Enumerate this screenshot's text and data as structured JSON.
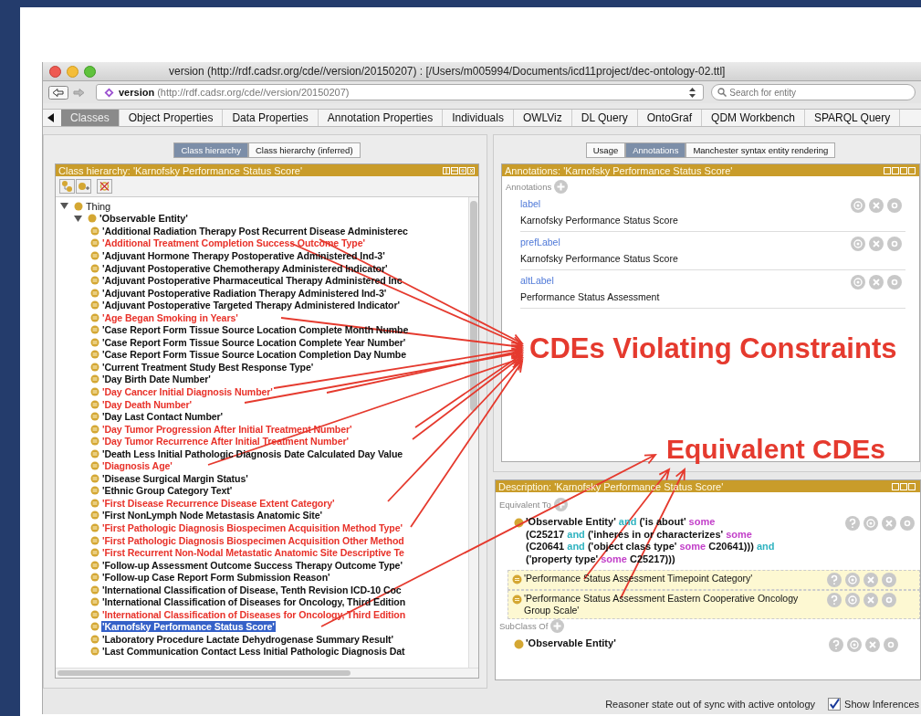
{
  "window": {
    "title": "version (http://rdf.cadsr.org/cde//version/20150207)  : [/Users/m005994/Documents/icd11project/dec-ontology-02.ttl]"
  },
  "address_bar": {
    "entity": "version",
    "iri": "(http://rdf.cadsr.org/cde//version/20150207)"
  },
  "search": {
    "placeholder": "Search for entity"
  },
  "tabs": [
    {
      "label": "Classes",
      "selected": true
    },
    {
      "label": "Object Properties",
      "selected": false
    },
    {
      "label": "Data Properties",
      "selected": false
    },
    {
      "label": "Annotation Properties",
      "selected": false
    },
    {
      "label": "Individuals",
      "selected": false
    },
    {
      "label": "OWLViz",
      "selected": false
    },
    {
      "label": "DL Query",
      "selected": false
    },
    {
      "label": "OntoGraf",
      "selected": false
    },
    {
      "label": "QDM Workbench",
      "selected": false
    },
    {
      "label": "SPARQL Query",
      "selected": false
    }
  ],
  "class_panel": {
    "tabs": [
      {
        "label": "Class hierarchy",
        "selected": true
      },
      {
        "label": "Class hierarchy (inferred)",
        "selected": false
      }
    ],
    "header": "Class hierarchy: 'Karnofsky Performance Status Score'",
    "tree": [
      {
        "label": "Thing",
        "expanded": true,
        "children": [
          {
            "label": "'Observable Entity'",
            "expanded": true,
            "children": [
              {
                "label": "'Additional Radiation Therapy Post Recurrent Disease Administerec",
                "flagged": false,
                "selected": false
              },
              {
                "label": "'Additional Treatment Completion Success Outcome Type'",
                "flagged": true,
                "selected": false
              },
              {
                "label": "'Adjuvant Hormone Therapy Postoperative Administered Ind-3'",
                "flagged": false,
                "selected": false
              },
              {
                "label": "'Adjuvant Postoperative Chemotherapy Administered Indicator'",
                "flagged": false,
                "selected": false
              },
              {
                "label": "'Adjuvant Postoperative Pharmaceutical Therapy Administered Inc",
                "flagged": false,
                "selected": false
              },
              {
                "label": "'Adjuvant Postoperative Radiation Therapy Administered Ind-3'",
                "flagged": false,
                "selected": false
              },
              {
                "label": "'Adjuvant Postoperative Targeted Therapy Administered Indicator'",
                "flagged": false,
                "selected": false
              },
              {
                "label": "'Age Began Smoking in Years'",
                "flagged": true,
                "selected": false
              },
              {
                "label": "'Case Report Form Tissue Source Location Complete Month Numbe",
                "flagged": false,
                "selected": false
              },
              {
                "label": "'Case Report Form Tissue Source Location Complete Year Number'",
                "flagged": false,
                "selected": false
              },
              {
                "label": "'Case Report Form Tissue Source Location Completion Day Numbe",
                "flagged": false,
                "selected": false
              },
              {
                "label": "'Current Treatment Study Best Response Type'",
                "flagged": false,
                "selected": false
              },
              {
                "label": "'Day Birth Date Number'",
                "flagged": false,
                "selected": false
              },
              {
                "label": "'Day Cancer Initial Diagnosis Number'",
                "flagged": true,
                "selected": false
              },
              {
                "label": "'Day Death Number'",
                "flagged": true,
                "selected": false
              },
              {
                "label": "'Day Last Contact Number'",
                "flagged": false,
                "selected": false
              },
              {
                "label": "'Day Tumor Progression After Initial Treatment Number'",
                "flagged": true,
                "selected": false
              },
              {
                "label": "'Day Tumor Recurrence After Initial Treatment Number'",
                "flagged": true,
                "selected": false
              },
              {
                "label": "'Death Less Initial Pathologic Diagnosis Date Calculated Day Value",
                "flagged": false,
                "selected": false
              },
              {
                "label": "'Diagnosis Age'",
                "flagged": true,
                "selected": false
              },
              {
                "label": "'Disease Surgical Margin Status'",
                "flagged": false,
                "selected": false
              },
              {
                "label": "'Ethnic Group Category Text'",
                "flagged": false,
                "selected": false
              },
              {
                "label": "'First Disease Recurrence Disease Extent Category'",
                "flagged": true,
                "selected": false
              },
              {
                "label": "'First NonLymph Node Metastasis Anatomic Site'",
                "flagged": false,
                "selected": false
              },
              {
                "label": "'First Pathologic Diagnosis Biospecimen Acquisition Method Type'",
                "flagged": true,
                "selected": false
              },
              {
                "label": "'First Pathologic Diagnosis Biospecimen Acquisition Other Method",
                "flagged": true,
                "selected": false
              },
              {
                "label": "'First Recurrent Non-Nodal Metastatic Anatomic Site Descriptive Te",
                "flagged": true,
                "selected": false
              },
              {
                "label": "'Follow-up Assessment Outcome Success Therapy Outcome Type'",
                "flagged": false,
                "selected": false
              },
              {
                "label": "'Follow-up Case Report Form Submission Reason'",
                "flagged": false,
                "selected": false
              },
              {
                "label": "'International Classification of Disease, Tenth Revision ICD-10 Coc",
                "flagged": false,
                "selected": false
              },
              {
                "label": "'International Classification of Diseases for Oncology, Third Edition",
                "flagged": false,
                "selected": false
              },
              {
                "label": "'International Classification of Diseases for Oncology, Third Edition",
                "flagged": true,
                "selected": false
              },
              {
                "label": "'Karnofsky Performance Status Score'",
                "flagged": false,
                "selected": true
              },
              {
                "label": "'Laboratory Procedure Lactate Dehydrogenase Summary Result'",
                "flagged": false,
                "selected": false
              },
              {
                "label": "'Last Communication Contact Less Initial Pathologic Diagnosis Dat",
                "flagged": false,
                "selected": false
              }
            ]
          }
        ]
      }
    ]
  },
  "usage_panel": {
    "tabs": [
      {
        "label": "Usage",
        "selected": false
      },
      {
        "label": "Annotations",
        "selected": true
      },
      {
        "label": "Manchester syntax entity rendering",
        "selected": false
      }
    ],
    "header": "Annotations: 'Karnofsky Performance Status Score'",
    "section_label": "Annotations",
    "annotations": [
      {
        "property": "label",
        "value": "Karnofsky Performance Status Score"
      },
      {
        "property": "prefLabel",
        "value": "Karnofsky Performance Status Score"
      },
      {
        "property": "altLabel",
        "value": "Performance Status Assessment"
      }
    ]
  },
  "description_panel": {
    "header": "Description: 'Karnofsky Performance Status Score'",
    "sections": [
      {
        "label": "Equivalent To",
        "items": [
          {
            "kind": "expression",
            "lines": [
              [
                {
                  "text": "'Observable Entity' ",
                  "kind": "name"
                },
                {
                  "text": "and",
                  "kind": "and"
                },
                {
                  "text": " ('is about' ",
                  "kind": "name"
                },
                {
                  "text": "some",
                  "kind": "some"
                }
              ],
              [
                {
                  "text": "(C25217 ",
                  "kind": "name"
                },
                {
                  "text": "and",
                  "kind": "and"
                },
                {
                  "text": " ('inheres in or characterizes' ",
                  "kind": "name"
                },
                {
                  "text": "some",
                  "kind": "some"
                }
              ],
              [
                {
                  "text": "(C20641 ",
                  "kind": "name"
                },
                {
                  "text": "and",
                  "kind": "and"
                },
                {
                  "text": " ('object class type' ",
                  "kind": "name"
                },
                {
                  "text": "some",
                  "kind": "some"
                },
                {
                  "text": " C20641))) ",
                  "kind": "name"
                },
                {
                  "text": "and",
                  "kind": "and"
                }
              ],
              [
                {
                  "text": "('property type' ",
                  "kind": "name"
                },
                {
                  "text": "some",
                  "kind": "some"
                },
                {
                  "text": " C25217)))",
                  "kind": "name"
                }
              ]
            ]
          },
          {
            "kind": "class",
            "text": "'Performance Status Assessment Timepoint Category'",
            "inferred": true
          },
          {
            "kind": "class",
            "text": "'Performance Status Assessment Eastern Cooperative Oncology Group Scale'",
            "inferred": true
          }
        ]
      },
      {
        "label": "SubClass Of",
        "items": [
          {
            "kind": "class",
            "text": "'Observable Entity'",
            "inferred": false
          }
        ]
      }
    ]
  },
  "status_bar": {
    "message": "Reasoner state out of sync with active ontology",
    "show_inferences": {
      "label": "Show Inferences",
      "checked": true
    }
  },
  "callouts": [
    {
      "text": "CDEs Violating Constraints"
    },
    {
      "text": "Equivalent CDEs"
    }
  ]
}
